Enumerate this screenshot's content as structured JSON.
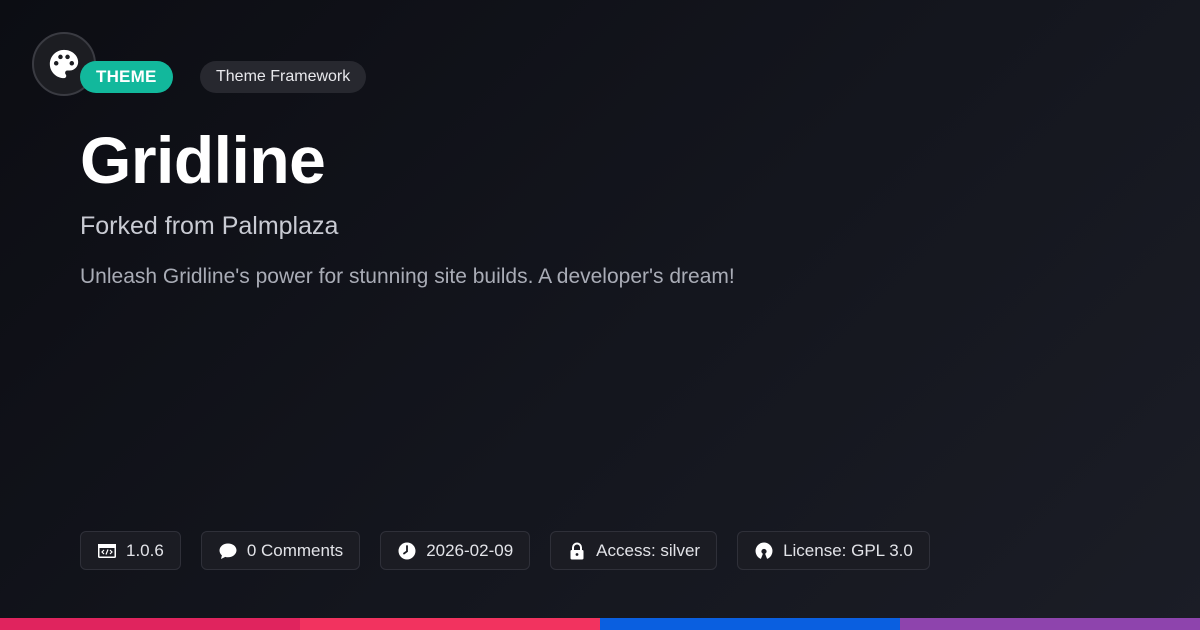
{
  "tags": {
    "type": "THEME",
    "category": "Theme Framework"
  },
  "hero": {
    "title": "Gridline",
    "subtitle": "Forked from Palmplaza",
    "description": "Unleash Gridline's power for stunning site builds. A developer's dream!"
  },
  "meta": [
    {
      "icon": "code-icon",
      "label": "1.0.6"
    },
    {
      "icon": "comment-icon",
      "label": "0 Comments"
    },
    {
      "icon": "clock-icon",
      "label": "2026-02-09"
    },
    {
      "icon": "lock-icon",
      "label": "Access: silver"
    },
    {
      "icon": "open-source-icon",
      "label": "License: GPL 3.0"
    }
  ],
  "colors": {
    "accent": "#12b89c",
    "bar": [
      "#e0245e",
      "#f2335f",
      "#0a5fe0",
      "#8e44ad"
    ]
  }
}
